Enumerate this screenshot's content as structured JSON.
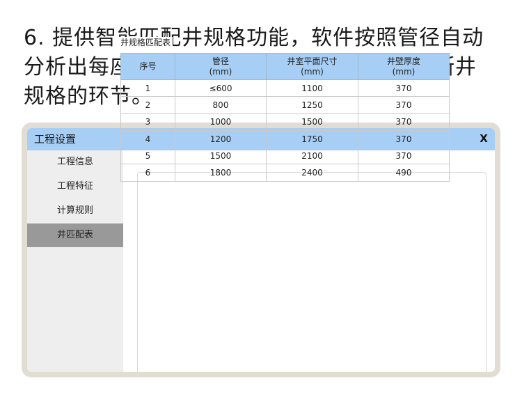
{
  "caption": {
    "lines": [
      "6. 提供智能匹配井规格功能，软件按照管径自动",
      "分析出每座井对应的尺寸，省去人工逐一判断井",
      "规格的环节。"
    ]
  },
  "window": {
    "title": "工程设置",
    "close_label": "X"
  },
  "sidebar": {
    "items": [
      {
        "label": "工程信息",
        "active": false
      },
      {
        "label": "工程特征",
        "active": false
      },
      {
        "label": "计算规则",
        "active": false
      },
      {
        "label": "井匹配表",
        "active": true
      }
    ]
  },
  "group": {
    "legend": "井规格匹配表"
  },
  "table": {
    "headers": [
      {
        "line1": "序号",
        "line2": ""
      },
      {
        "line1": "管径",
        "line2": "(mm)"
      },
      {
        "line1": "井室平面尺寸",
        "line2": "(mm)"
      },
      {
        "line1": "井壁厚度",
        "line2": "(mm)"
      }
    ],
    "rows": [
      [
        "1",
        "≤600",
        "1100",
        "370"
      ],
      [
        "2",
        "800",
        "1250",
        "370"
      ],
      [
        "3",
        "1000",
        "1500",
        "370"
      ],
      [
        "4",
        "1200",
        "1750",
        "370"
      ],
      [
        "5",
        "1500",
        "2100",
        "370"
      ],
      [
        "6",
        "1800",
        "2400",
        "490"
      ]
    ]
  },
  "colors": {
    "accent": "#a7cff5",
    "active_nav": "#999999",
    "sidebar_bg": "#eeeeee",
    "frame": "#e1ddd2"
  }
}
